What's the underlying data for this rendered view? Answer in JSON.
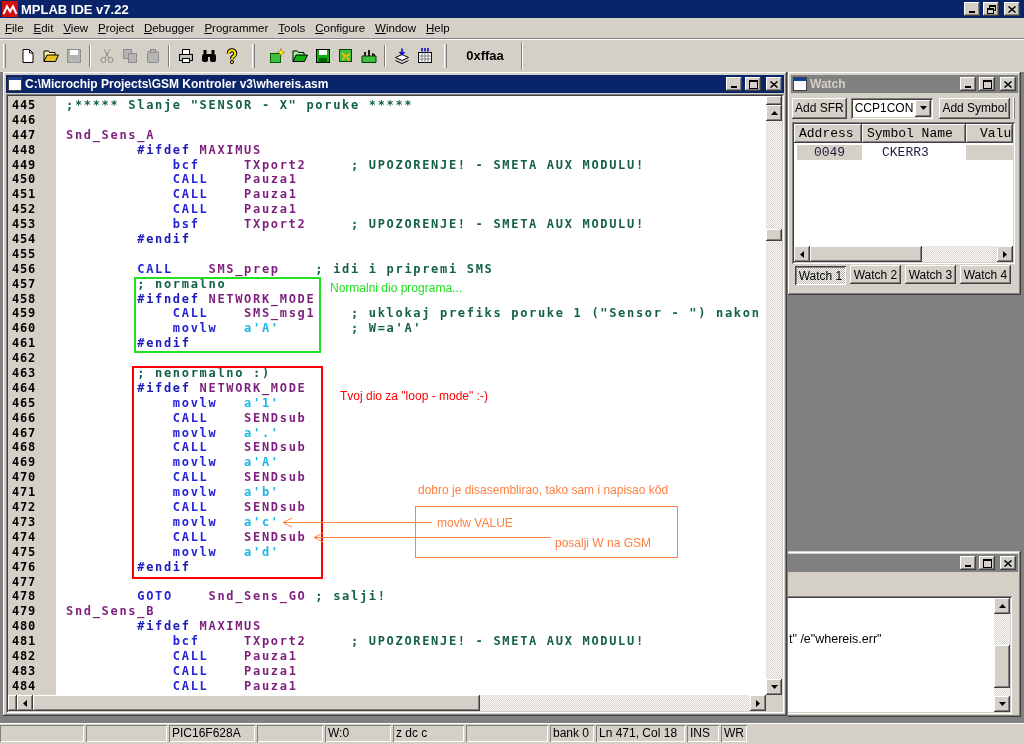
{
  "window": {
    "title": "MPLAB IDE v7.22"
  },
  "menu": [
    "File",
    "Edit",
    "View",
    "Project",
    "Debugger",
    "Programmer",
    "Tools",
    "Configure",
    "Window",
    "Help"
  ],
  "toolbar": {
    "bands": [
      [
        [
          {
            "kind": "new",
            "disabled": false
          },
          {
            "kind": "open",
            "disabled": false
          },
          {
            "kind": "save",
            "disabled": true
          }
        ],
        [
          {
            "kind": "cut",
            "disabled": true
          },
          {
            "kind": "copy",
            "disabled": true
          },
          {
            "kind": "paste",
            "disabled": true
          }
        ],
        [
          {
            "kind": "print",
            "disabled": false
          },
          {
            "kind": "find",
            "disabled": false
          },
          {
            "kind": "help",
            "disabled": false
          }
        ]
      ],
      [
        [
          {
            "kind": "new_project",
            "disabled": false
          },
          {
            "kind": "open_project",
            "disabled": false
          },
          {
            "kind": "save_project",
            "disabled": false
          },
          {
            "kind": "board",
            "disabled": false
          },
          {
            "kind": "folder_factory",
            "disabled": false
          }
        ],
        [
          {
            "kind": "stack_arrow",
            "disabled": false
          },
          {
            "kind": "grid_arrow",
            "disabled": false
          }
        ]
      ]
    ],
    "hex_readout": "0xffaa"
  },
  "editor": {
    "title": "C:\\Microchip Projects\\GSM Kontroler v3\\whereis.asm",
    "active": true,
    "lines": [
      {
        "number": "445",
        "segments": [
          {
            "kind": "comment",
            "text": ";***** Slanje \"SENSOR - X\" poruke *****"
          }
        ]
      },
      {
        "number": "446"
      },
      {
        "number": "447",
        "segments": [
          {
            "kind": "label",
            "text": "Snd_Sens_A"
          }
        ]
      },
      {
        "number": "448",
        "segments": [
          {
            "kind": "directive",
            "text": "        #ifdef"
          },
          {
            "kind": "symbol",
            "text": " MAXIMUS"
          }
        ]
      },
      {
        "number": "449",
        "segments": [
          {
            "kind": "mnemonic",
            "text": "            bcf"
          },
          {
            "kind": "symbol",
            "text": "     TXport2"
          },
          {
            "kind": "comment",
            "text": "     ; UPOZORENJE! - SMETA AUX MODULU!"
          }
        ]
      },
      {
        "number": "450",
        "segments": [
          {
            "kind": "mnemonic",
            "text": "            CALL"
          },
          {
            "kind": "symbol",
            "text": "    Pauza1"
          }
        ]
      },
      {
        "number": "451",
        "segments": [
          {
            "kind": "mnemonic",
            "text": "            CALL"
          },
          {
            "kind": "symbol",
            "text": "    Pauza1"
          }
        ]
      },
      {
        "number": "452",
        "segments": [
          {
            "kind": "mnemonic",
            "text": "            CALL"
          },
          {
            "kind": "symbol",
            "text": "    Pauza1"
          }
        ]
      },
      {
        "number": "453",
        "segments": [
          {
            "kind": "mnemonic",
            "text": "            bsf"
          },
          {
            "kind": "symbol",
            "text": "     TXport2"
          },
          {
            "kind": "comment",
            "text": "     ; UPOZORENJE! - SMETA AUX MODULU!"
          }
        ]
      },
      {
        "number": "454",
        "segments": [
          {
            "kind": "directive",
            "text": "        #endif"
          }
        ]
      },
      {
        "number": "455"
      },
      {
        "number": "456",
        "segments": [
          {
            "kind": "mnemonic",
            "text": "        CALL"
          },
          {
            "kind": "symbol",
            "text": "    SMS_prep"
          },
          {
            "kind": "comment",
            "text": "    ; idi i pripremi SMS"
          }
        ]
      },
      {
        "number": "457",
        "segments": [
          {
            "kind": "comment",
            "text": "        ; normalno"
          }
        ]
      },
      {
        "number": "458",
        "segments": [
          {
            "kind": "directive",
            "text": "        #ifndef"
          },
          {
            "kind": "symbol",
            "text": " NETWORK_MODE"
          }
        ]
      },
      {
        "number": "459",
        "segments": [
          {
            "kind": "mnemonic",
            "text": "            CALL"
          },
          {
            "kind": "symbol",
            "text": "    SMS_msg1"
          },
          {
            "kind": "comment",
            "text": "    ; uklokaj prefiks poruke 1 (\"Sensor - \") nakon"
          }
        ]
      },
      {
        "number": "460",
        "segments": [
          {
            "kind": "mnemonic",
            "text": "            movlw"
          },
          {
            "kind": "literal",
            "text": "   a'A'"
          },
          {
            "kind": "comment",
            "text": "        ; W=a'A'"
          }
        ]
      },
      {
        "number": "461",
        "segments": [
          {
            "kind": "directive",
            "text": "        #endif"
          }
        ]
      },
      {
        "number": "462"
      },
      {
        "number": "463",
        "segments": [
          {
            "kind": "comment",
            "text": "        ; nenormalno :)"
          }
        ]
      },
      {
        "number": "464",
        "segments": [
          {
            "kind": "directive",
            "text": "        #ifdef"
          },
          {
            "kind": "symbol",
            "text": " NETWORK_MODE"
          }
        ]
      },
      {
        "number": "465",
        "segments": [
          {
            "kind": "mnemonic",
            "text": "            movlw"
          },
          {
            "kind": "literal",
            "text": "   a'1'"
          }
        ]
      },
      {
        "number": "466",
        "segments": [
          {
            "kind": "mnemonic",
            "text": "            CALL"
          },
          {
            "kind": "symbol",
            "text": "    SENDsub"
          }
        ]
      },
      {
        "number": "467",
        "segments": [
          {
            "kind": "mnemonic",
            "text": "            movlw"
          },
          {
            "kind": "literal",
            "text": "   a'.'"
          }
        ]
      },
      {
        "number": "468",
        "segments": [
          {
            "kind": "mnemonic",
            "text": "            CALL"
          },
          {
            "kind": "symbol",
            "text": "    SENDsub"
          }
        ]
      },
      {
        "number": "469",
        "segments": [
          {
            "kind": "mnemonic",
            "text": "            movlw"
          },
          {
            "kind": "literal",
            "text": "   a'A'"
          }
        ]
      },
      {
        "number": "470",
        "segments": [
          {
            "kind": "mnemonic",
            "text": "            CALL"
          },
          {
            "kind": "symbol",
            "text": "    SENDsub"
          }
        ]
      },
      {
        "number": "471",
        "segments": [
          {
            "kind": "mnemonic",
            "text": "            movlw"
          },
          {
            "kind": "literal",
            "text": "   a'b'"
          }
        ]
      },
      {
        "number": "472",
        "segments": [
          {
            "kind": "mnemonic",
            "text": "            CALL"
          },
          {
            "kind": "symbol",
            "text": "    SENDsub"
          }
        ]
      },
      {
        "number": "473",
        "segments": [
          {
            "kind": "mnemonic",
            "text": "            movlw"
          },
          {
            "kind": "literal",
            "text": "   a'c'"
          }
        ]
      },
      {
        "number": "474",
        "segments": [
          {
            "kind": "mnemonic",
            "text": "            CALL"
          },
          {
            "kind": "symbol",
            "text": "    SENDsub"
          }
        ]
      },
      {
        "number": "475",
        "segments": [
          {
            "kind": "mnemonic",
            "text": "            movlw"
          },
          {
            "kind": "literal",
            "text": "   a'd'"
          }
        ]
      },
      {
        "number": "476",
        "segments": [
          {
            "kind": "directive",
            "text": "        #endif"
          }
        ]
      },
      {
        "number": "477"
      },
      {
        "number": "478",
        "segments": [
          {
            "kind": "mnemonic",
            "text": "        GOTO"
          },
          {
            "kind": "symbol",
            "text": "    Snd_Sens_GO"
          },
          {
            "kind": "comment",
            "text": " ; salji!"
          }
        ]
      },
      {
        "number": "479",
        "segments": [
          {
            "kind": "label",
            "text": "Snd_Sens_B"
          }
        ]
      },
      {
        "number": "480",
        "segments": [
          {
            "kind": "directive",
            "text": "        #ifdef"
          },
          {
            "kind": "symbol",
            "text": " MAXIMUS"
          }
        ]
      },
      {
        "number": "481",
        "segments": [
          {
            "kind": "mnemonic",
            "text": "            bcf"
          },
          {
            "kind": "symbol",
            "text": "     TXport2"
          },
          {
            "kind": "comment",
            "text": "     ; UPOZORENJE! - SMETA AUX MODULU!"
          }
        ]
      },
      {
        "number": "482",
        "segments": [
          {
            "kind": "mnemonic",
            "text": "            CALL"
          },
          {
            "kind": "symbol",
            "text": "    Pauza1"
          }
        ]
      },
      {
        "number": "483",
        "segments": [
          {
            "kind": "mnemonic",
            "text": "            CALL"
          },
          {
            "kind": "symbol",
            "text": "    Pauza1"
          }
        ]
      },
      {
        "number": "484",
        "segments": [
          {
            "kind": "mnemonic",
            "text": "            CALL"
          },
          {
            "kind": "symbol",
            "text": "    Pauza1"
          }
        ]
      }
    ],
    "annotations": [
      {
        "kind": "frame",
        "color": "#20e020"
      },
      {
        "kind": "note",
        "color": "#20e020",
        "text": "Normalni dio programa..."
      },
      {
        "kind": "frame",
        "color": "#ff0000"
      },
      {
        "kind": "note",
        "color": "#ff0000",
        "text": "Tvoj dio za \"loop - mode\" :-)"
      },
      {
        "kind": "note",
        "color": "#ff8040",
        "text": "dobro je disasemblirao, tako sam i napisao kôd"
      },
      {
        "kind": "frame",
        "color": "#ff8040"
      },
      {
        "kind": "note",
        "color": "#ff8040",
        "text": "movlw VALUE"
      },
      {
        "kind": "arrow",
        "color": "#ff8040"
      },
      {
        "kind": "note",
        "color": "#ff8040",
        "text": "posalji W na GSM"
      },
      {
        "kind": "arrow",
        "color": "#ff8040"
      }
    ]
  },
  "watch": {
    "title": "Watch",
    "active": false,
    "add_sfr": "Add SFR",
    "sfr_select": "CCP1CON",
    "add_symbol": "Add Symbol",
    "columns": [
      "Address",
      "Symbol Name",
      "Valu"
    ],
    "rows": [
      {
        "address": "0049",
        "symbol_name": "CKERR3"
      }
    ],
    "tabs": [
      {
        "label": "Watch 1",
        "selected": true
      },
      {
        "label": "Watch 2",
        "selected": false
      },
      {
        "label": "Watch 3",
        "selected": false
      },
      {
        "label": "Watch 4",
        "selected": false
      }
    ]
  },
  "output": {
    "active": false,
    "lines": [
      "t\" /e\"whereis.err\""
    ]
  },
  "status_bar": [
    {
      "kind": "empty"
    },
    {
      "kind": "empty"
    },
    {
      "kind": "text",
      "text": "PIC16F628A"
    },
    {
      "kind": "empty"
    },
    {
      "kind": "text",
      "text": "W:0"
    },
    {
      "kind": "text",
      "text": "z dc c"
    },
    {
      "kind": "empty"
    },
    {
      "kind": "text",
      "text": "bank 0"
    },
    {
      "kind": "text",
      "text": "Ln 471, Col 18"
    },
    {
      "kind": "text",
      "text": "INS"
    },
    {
      "kind": "text",
      "text": "WR"
    }
  ]
}
